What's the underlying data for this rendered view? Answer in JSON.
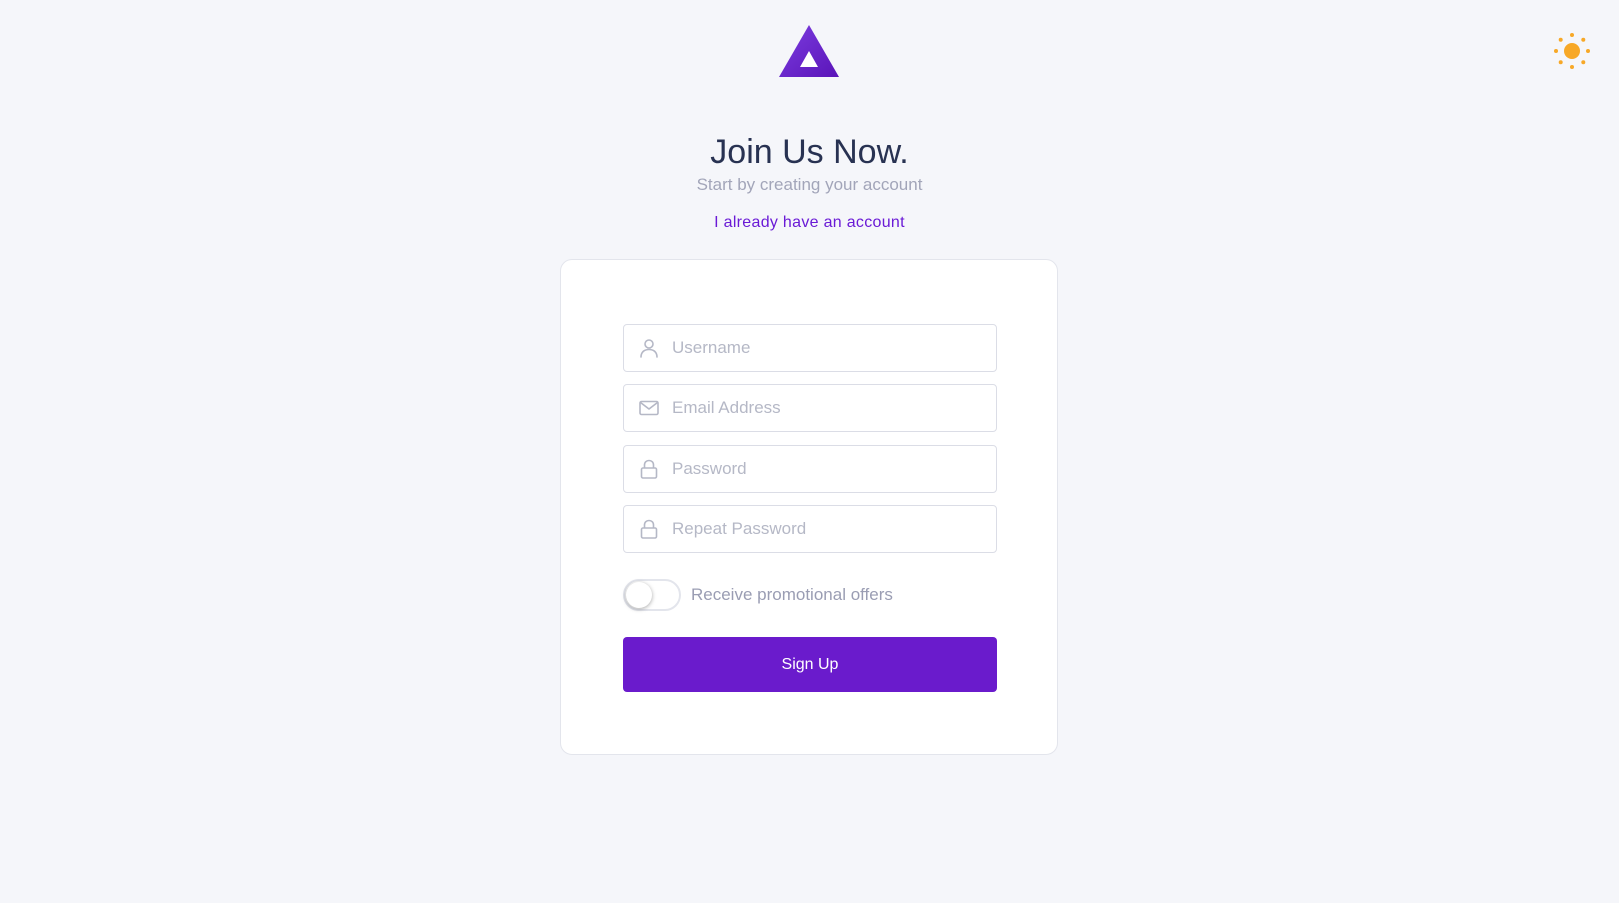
{
  "header": {
    "logo_icon": "triangle-logo-icon",
    "theme_toggle_icon": "sun-icon",
    "accent_color": "#6a1bcc",
    "sun_color": "#f7a827"
  },
  "intro": {
    "title": "Join Us Now.",
    "subtitle": "Start by creating your account",
    "login_link": "I already have an account"
  },
  "form": {
    "username": {
      "placeholder": "Username",
      "value": "",
      "icon": "user-icon"
    },
    "email": {
      "placeholder": "Email Address",
      "value": "",
      "icon": "envelope-icon"
    },
    "password": {
      "placeholder": "Password",
      "value": "",
      "icon": "lock-icon"
    },
    "repeat_password": {
      "placeholder": "Repeat Password",
      "value": "",
      "icon": "lock-icon"
    },
    "promo_toggle": {
      "label": "Receive promotional offers",
      "checked": false
    },
    "submit_label": "Sign Up"
  }
}
